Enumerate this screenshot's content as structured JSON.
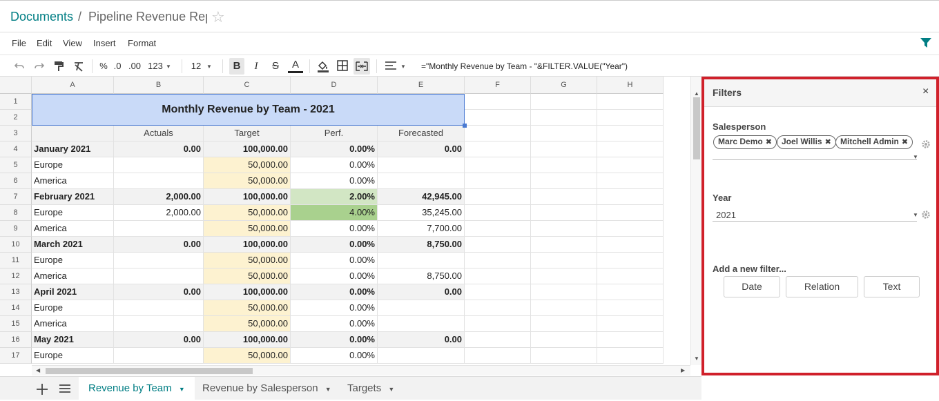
{
  "breadcrumb": {
    "root": "Documents",
    "separator": "/",
    "title": "Pipeline Revenue Rep"
  },
  "menu": [
    "File",
    "Edit",
    "View",
    "Insert",
    "Format"
  ],
  "toolbar": {
    "percent": "%",
    "dec_less": ".0",
    "dec_more": ".00",
    "num_format": "123",
    "font_size": "12",
    "formula": "=\"Monthly Revenue by Team - \"&FILTER.VALUE(\"Year\")"
  },
  "columns": [
    "A",
    "B",
    "C",
    "D",
    "E",
    "F",
    "G",
    "H"
  ],
  "rows": [
    "1",
    "2",
    "3",
    "4",
    "5",
    "6",
    "7",
    "8",
    "9",
    "10",
    "11",
    "12",
    "13",
    "14",
    "15",
    "16",
    "17"
  ],
  "sheet": {
    "title": "Monthly Revenue by Team - 2021",
    "headers": [
      "",
      "Actuals",
      "Target",
      "Perf.",
      "Forecasted"
    ],
    "data": [
      {
        "label": "January 2021",
        "actuals": "0.00",
        "target": "100,000.00",
        "perf": "0.00%",
        "forecast": "0.00",
        "bold": true
      },
      {
        "label": "Europe",
        "actuals": "",
        "target": "50,000.00",
        "perf": "0.00%",
        "forecast": ""
      },
      {
        "label": "America",
        "actuals": "",
        "target": "50,000.00",
        "perf": "0.00%",
        "forecast": ""
      },
      {
        "label": "February 2021",
        "actuals": "2,000.00",
        "target": "100,000.00",
        "perf": "2.00%",
        "forecast": "42,945.00",
        "bold": true
      },
      {
        "label": "Europe",
        "actuals": "2,000.00",
        "target": "50,000.00",
        "perf": "4.00%",
        "forecast": "35,245.00"
      },
      {
        "label": "America",
        "actuals": "",
        "target": "50,000.00",
        "perf": "0.00%",
        "forecast": "7,700.00"
      },
      {
        "label": "March 2021",
        "actuals": "0.00",
        "target": "100,000.00",
        "perf": "0.00%",
        "forecast": "8,750.00",
        "bold": true
      },
      {
        "label": "Europe",
        "actuals": "",
        "target": "50,000.00",
        "perf": "0.00%",
        "forecast": ""
      },
      {
        "label": "America",
        "actuals": "",
        "target": "50,000.00",
        "perf": "0.00%",
        "forecast": "8,750.00"
      },
      {
        "label": "April 2021",
        "actuals": "0.00",
        "target": "100,000.00",
        "perf": "0.00%",
        "forecast": "0.00",
        "bold": true
      },
      {
        "label": "Europe",
        "actuals": "",
        "target": "50,000.00",
        "perf": "0.00%",
        "forecast": ""
      },
      {
        "label": "America",
        "actuals": "",
        "target": "50,000.00",
        "perf": "0.00%",
        "forecast": ""
      },
      {
        "label": "May 2021",
        "actuals": "0.00",
        "target": "100,000.00",
        "perf": "0.00%",
        "forecast": "0.00",
        "bold": true
      },
      {
        "label": "Europe",
        "actuals": "",
        "target": "50,000.00",
        "perf": "0.00%",
        "forecast": ""
      }
    ]
  },
  "colors": {
    "accent": "#017e84",
    "title_bg": "#c9daf8",
    "target_bg": "#fdf2d0",
    "perf_green_light": "#d2e6c4",
    "perf_green": "#a9d18e",
    "panel_border": "#d0202a"
  },
  "sheet_tabs": [
    {
      "label": "Revenue by Team",
      "active": true
    },
    {
      "label": "Revenue by Salesperson",
      "active": false
    },
    {
      "label": "Targets",
      "active": false
    }
  ],
  "filters": {
    "title": "Filters",
    "close": "×",
    "salesperson_label": "Salesperson",
    "salesperson_tags": [
      "Marc Demo",
      "Joel Willis",
      "Mitchell Admin"
    ],
    "year_label": "Year",
    "year_value": "2021",
    "add_label": "Add a new filter...",
    "buttons": [
      "Date",
      "Relation",
      "Text"
    ]
  }
}
